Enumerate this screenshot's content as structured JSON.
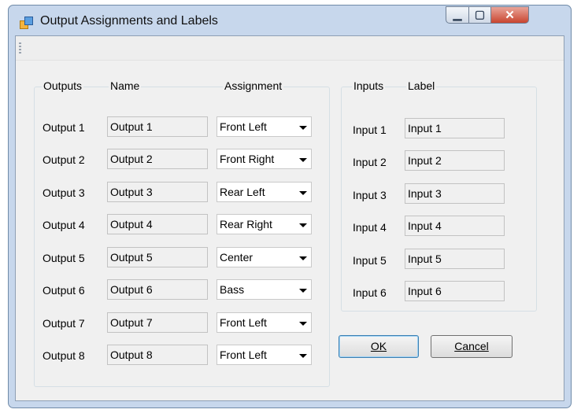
{
  "window": {
    "title": "Output Assignments and Labels",
    "app_icon": "app-icon",
    "controls": {
      "minimize": "minimize-icon",
      "maximize": "maximize-icon",
      "close": "close-icon"
    }
  },
  "outputs": {
    "headers": {
      "outputs": "Outputs",
      "name": "Name",
      "assignment": "Assignment"
    },
    "rows": [
      {
        "label": "Output 1",
        "name": "Output  1",
        "assignment": "Front Left"
      },
      {
        "label": "Output 2",
        "name": "Output  2",
        "assignment": "Front Right"
      },
      {
        "label": "Output 3",
        "name": "Output  3",
        "assignment": "Rear Left"
      },
      {
        "label": "Output 4",
        "name": "Output  4",
        "assignment": "Rear Right"
      },
      {
        "label": "Output 5",
        "name": "Output  5",
        "assignment": "Center"
      },
      {
        "label": "Output 6",
        "name": "Output  6",
        "assignment": "Bass"
      },
      {
        "label": "Output 7",
        "name": "Output  7",
        "assignment": "Front Left"
      },
      {
        "label": "Output 8",
        "name": "Output  8",
        "assignment": "Front Left"
      }
    ]
  },
  "inputs": {
    "headers": {
      "inputs": "Inputs",
      "label": "Label"
    },
    "rows": [
      {
        "label": "Input 1",
        "value": "Input 1"
      },
      {
        "label": "Input 2",
        "value": "Input 2"
      },
      {
        "label": "Input 3",
        "value": "Input 3"
      },
      {
        "label": "Input 4",
        "value": "Input 4"
      },
      {
        "label": "Input 5",
        "value": "Input 5"
      },
      {
        "label": "Input 6",
        "value": "Input 6"
      }
    ]
  },
  "buttons": {
    "ok": "OK",
    "cancel": "Cancel"
  }
}
